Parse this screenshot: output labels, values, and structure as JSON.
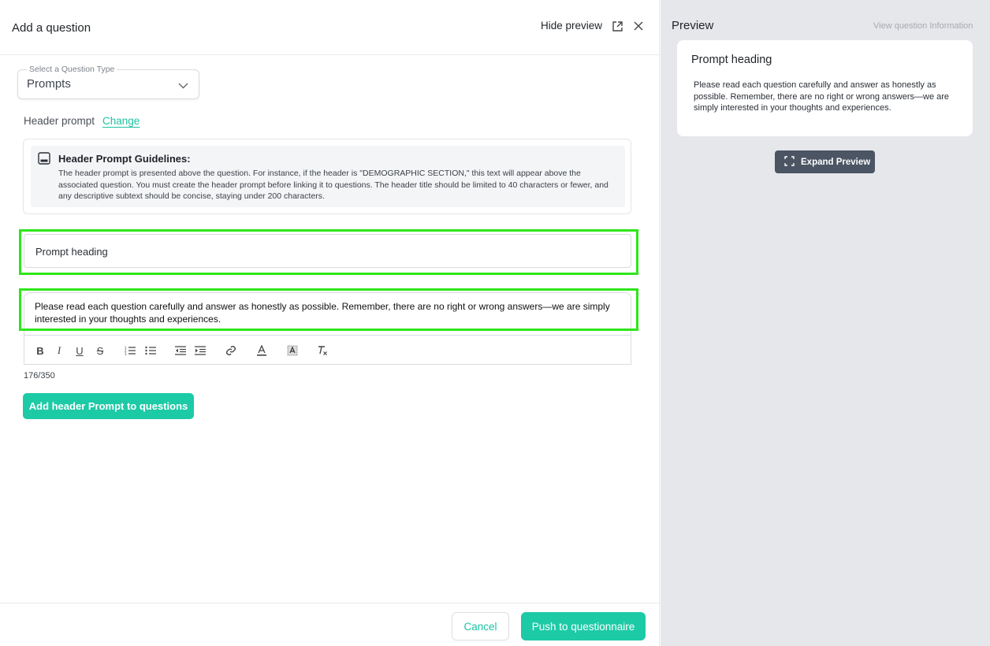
{
  "header": {
    "title": "Add a question",
    "hide_preview": "Hide preview"
  },
  "question_type": {
    "label": "Select a Question Type",
    "value": "Prompts"
  },
  "header_prompt": {
    "label": "Header prompt",
    "change": "Change"
  },
  "guidelines": {
    "title": "Header Prompt Guidelines:",
    "text": "The header prompt is presented above the question. For instance, if the header is \"DEMOGRAPHIC SECTION,\" this text will appear above the associated question. You must create the header prompt before linking it to questions. The header title should be limited to 40 characters or fewer, and any descriptive subtext should be concise, staying under 200 characters."
  },
  "heading_input": {
    "value": "Prompt heading"
  },
  "editor": {
    "text": "Please read each question carefully and answer as honestly as possible. Remember, there are no right or wrong answers—we are simply interested in your thoughts and experiences.",
    "counter": "176/350",
    "toolbar": [
      "bold-icon",
      "italic-icon",
      "underline-icon",
      "strikethrough-icon",
      "ordered-list-icon",
      "bullet-list-icon",
      "outdent-icon",
      "indent-icon",
      "link-icon",
      "text-color-icon",
      "highlight-icon",
      "clear-format-icon"
    ]
  },
  "actions": {
    "add_header": "Add header Prompt to questions",
    "cancel": "Cancel",
    "push": "Push to questionnaire"
  },
  "preview": {
    "title": "Preview",
    "view_info": "View question Information",
    "heading": "Prompt heading",
    "text": "Please read each question carefully and answer as honestly as possible. Remember, there are no right or wrong answers—we are simply interested in your thoughts and experiences.",
    "expand": "Expand Preview"
  },
  "colors": {
    "accent": "#1dcaa6",
    "highlight_box": "#2ee619",
    "expand_button": "#4b5563"
  }
}
